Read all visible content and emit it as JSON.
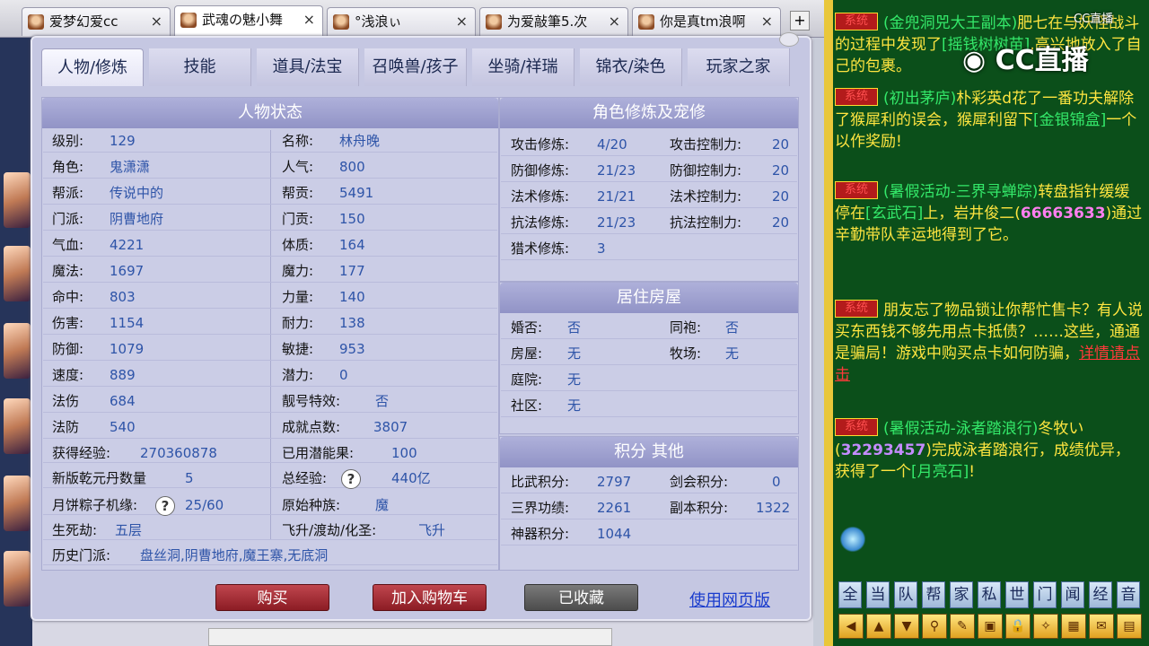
{
  "browser_tabs": [
    {
      "label": "爱梦幻爱cc",
      "close": "×",
      "active": false
    },
    {
      "label": "武魂の魅小舞",
      "close": "×",
      "active": true
    },
    {
      "label": "°浅浪ぃ",
      "close": "×",
      "active": false
    },
    {
      "label": "为爱敲筆5.次",
      "close": "×",
      "active": false
    },
    {
      "label": "你是真tm浪啊",
      "close": "×",
      "active": false
    }
  ],
  "tab_plus": "+",
  "nav_tabs": [
    "人物/修炼",
    "技能",
    "道具/法宝",
    "召唤兽/孩子",
    "坐骑/祥瑞",
    "锦衣/染色",
    "玩家之家"
  ],
  "character": {
    "title": "人物状态",
    "left": [
      {
        "label": "级别:",
        "value": "129"
      },
      {
        "label": "角色:",
        "value": "鬼潇潇"
      },
      {
        "label": "帮派:",
        "value": "传说中的"
      },
      {
        "label": "门派:",
        "value": "阴曹地府"
      },
      {
        "label": "气血:",
        "value": "4221"
      },
      {
        "label": "魔法:",
        "value": "1697"
      },
      {
        "label": "命中:",
        "value": "803"
      },
      {
        "label": "伤害:",
        "value": "1154"
      },
      {
        "label": "防御:",
        "value": "1079"
      },
      {
        "label": "速度:",
        "value": "889"
      },
      {
        "label": "法伤",
        "value": "684"
      },
      {
        "label": "法防",
        "value": "540"
      }
    ],
    "right": [
      {
        "label": "名称:",
        "value": "林舟晚"
      },
      {
        "label": "人气:",
        "value": "800"
      },
      {
        "label": "帮贡:",
        "value": "5491"
      },
      {
        "label": "门贡:",
        "value": "150"
      },
      {
        "label": "体质:",
        "value": "164"
      },
      {
        "label": "魔力:",
        "value": "177"
      },
      {
        "label": "力量:",
        "value": "140"
      },
      {
        "label": "耐力:",
        "value": "138"
      },
      {
        "label": "敏捷:",
        "value": "953"
      },
      {
        "label": "潜力:",
        "value": "0"
      },
      {
        "label": "靓号特效:",
        "value": "否"
      },
      {
        "label": "成就点数:",
        "value": "3807"
      }
    ],
    "exp": {
      "label": "获得经验:",
      "value": "270360878"
    },
    "fruit": {
      "label": "已用潜能果:",
      "value": "100"
    },
    "qianyuan": {
      "label": "新版乾元丹数量",
      "value": "5"
    },
    "total_exp": {
      "label": "总经验:",
      "value": "440亿"
    },
    "mooncake": {
      "label": "月饼粽子机缘:",
      "value": "25/60"
    },
    "race": {
      "label": "原始种族:",
      "value": "魔"
    },
    "shengsijie": {
      "label": "生死劫:",
      "value": "五层"
    },
    "feisheng": {
      "label": "飞升/渡劫/化圣:",
      "value": "飞升"
    },
    "history": {
      "label": "历史门派:",
      "value": "盘丝洞,阴曹地府,魔王寨,无底洞"
    },
    "q_mark": "?"
  },
  "cultivation": {
    "title": "角色修炼及宠修",
    "rows": [
      {
        "l1": "攻击修炼:",
        "v1": "4/20",
        "l2": "攻击控制力:",
        "v2": "20"
      },
      {
        "l1": "防御修炼:",
        "v1": "21/23",
        "l2": "防御控制力:",
        "v2": "20"
      },
      {
        "l1": "法术修炼:",
        "v1": "21/21",
        "l2": "法术控制力:",
        "v2": "20"
      },
      {
        "l1": "抗法修炼:",
        "v1": "21/23",
        "l2": "抗法控制力:",
        "v2": "20"
      },
      {
        "l1": "猎术修炼:",
        "v1": "3",
        "l2": "",
        "v2": ""
      }
    ]
  },
  "housing": {
    "title": "居住房屋",
    "rows": [
      {
        "l1": "婚否:",
        "v1": "否",
        "l2": "同袍:",
        "v2": "否"
      },
      {
        "l1": "房屋:",
        "v1": "无",
        "l2": "牧场:",
        "v2": "无"
      },
      {
        "l1": "庭院:",
        "v1": "无",
        "l2": "",
        "v2": ""
      },
      {
        "l1": "社区:",
        "v1": "无",
        "l2": "",
        "v2": ""
      }
    ]
  },
  "points": {
    "title": "积分 其他",
    "rows": [
      {
        "l1": "比武积分:",
        "v1": "2797",
        "l2": "剑会积分:",
        "v2": "0"
      },
      {
        "l1": "三界功绩:",
        "v1": "2261",
        "l2": "副本积分:",
        "v2": "1322"
      },
      {
        "l1": "神器积分:",
        "v1": "1044",
        "l2": "",
        "v2": ""
      }
    ]
  },
  "buttons": {
    "buy": "购买",
    "cart": "加入购物车",
    "fav": "已收藏",
    "web": "使用网页版"
  },
  "chat": {
    "sys_label": "系统",
    "brand": "CC直播",
    "brand_small": "CC直播",
    "m1a": "(金兜洞兕大王副本)",
    "m1b": "肥七在与妖怪战斗的过程中发现了",
    "m1c": "[摇钱树树苗]",
    "m1d": ",高兴地放入了自己的包裹。",
    "m2a": "(初出茅庐)",
    "m2b": "朴彩英d",
    "m2c": "花了一番功夫解除了猴犀利的误会，猴犀利留下",
    "m2d": "[金银锦盒]",
    "m2e": "一个以作奖励!",
    "m3a": "(暑假活动-三界寻蝉踪)",
    "m3b": "转盘指针缓缓停在",
    "m3c": "[玄武石]",
    "m3d": "上，岩井俊二(",
    "m3e": "66663633",
    "m3f": ")通过辛勤带队幸运地得到了它。",
    "m4a": "朋友忘了物品锁让你帮忙售卡？有人说买东西钱不够先用点卡抵债？……这些，通通是骗局！游戏中购买点卡如何防骗，",
    "m4b": "详情请点击",
    "m5a": "(暑假活动-泳者踏浪行)",
    "m5b": "冬牧い(",
    "m5c": "32293457",
    "m5d": ")完成泳者踏浪行，成绩优异，获得了一个",
    "m5e": "[月亮石]",
    "m5f": "!"
  },
  "chat_buttons": [
    "全",
    "当",
    "队",
    "帮",
    "家",
    "私",
    "世",
    "门",
    "闻",
    "经",
    "音"
  ]
}
